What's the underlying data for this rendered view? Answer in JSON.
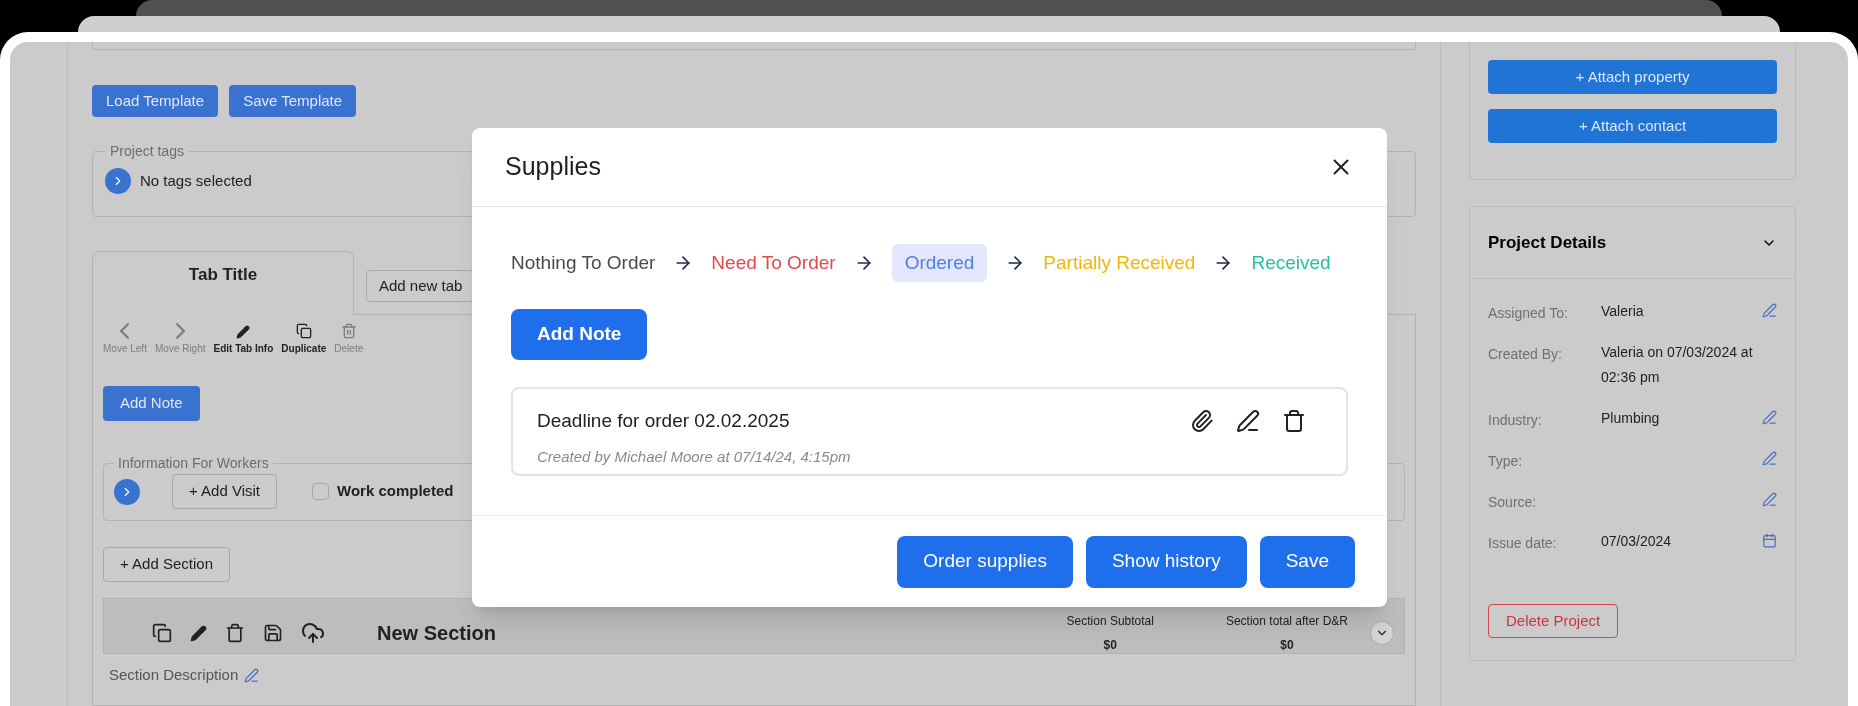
{
  "template_buttons": [
    "Load Template",
    "Save Template"
  ],
  "project_tags": {
    "legend": "Project tags",
    "value": "No tags selected"
  },
  "tabs": [
    {
      "label": "Tab Title",
      "selected": true
    }
  ],
  "add_tab_button": "Add new tab",
  "tab_toolbar": [
    {
      "kind": "left",
      "label": "Move Left",
      "disabled": true
    },
    {
      "kind": "right",
      "label": "Move Right",
      "disabled": true
    },
    {
      "kind": "edit",
      "label": "Edit Tab Info",
      "disabled": false
    },
    {
      "kind": "duplicate",
      "label": "Duplicate",
      "disabled": false
    },
    {
      "kind": "delete",
      "label": "Delete",
      "disabled": true
    }
  ],
  "add_note_button": "Add Note",
  "workers_info": {
    "legend": "Information For Workers",
    "add_visit": "+ Add Visit",
    "work_completed": {
      "label": "Work completed",
      "checked": false
    }
  },
  "add_section_button": "+ Add Section",
  "section": {
    "title": "New Section",
    "expanded": false,
    "totals": [
      {
        "label": "Section Subtotal",
        "value": "$0"
      },
      {
        "label": "Section total after D&R",
        "value": "$0"
      }
    ],
    "description_label": "Section Description"
  },
  "side_buttons": [
    "+ Attach property",
    "+ Attach contact"
  ],
  "project_details": {
    "title": "Project Details",
    "expanded": true,
    "rows": [
      {
        "label": "Assigned To:",
        "value": "Valeria",
        "kind": "edit"
      },
      {
        "label": "Created By:",
        "value": "Valeria on 07/03/2024 at 02:36 pm",
        "kind": "none"
      },
      {
        "label": "Industry:",
        "value": "Plumbing",
        "kind": "edit"
      },
      {
        "label": "Type:",
        "kind": "edit"
      },
      {
        "label": "Source:",
        "kind": "edit"
      },
      {
        "label": "Issue date:",
        "value": "07/03/2024",
        "kind": "date"
      }
    ]
  },
  "delete_button": "Delete Project",
  "modal": {
    "title": "Supplies",
    "statuses": [
      {
        "label": "Nothing To Order",
        "color": "#4a4a4a",
        "selected": false
      },
      {
        "label": "Need To Order",
        "color": "#e5484d",
        "selected": false
      },
      {
        "label": "Ordered",
        "color": "#4f7fe8",
        "selected": true
      },
      {
        "label": "Partially Received",
        "color": "#f2b705",
        "selected": false
      },
      {
        "label": "Received",
        "color": "#22c39a",
        "selected": false
      }
    ],
    "add_note_button": "Add Note",
    "notes": [
      {
        "text": "Deadline for order 02.02.2025",
        "meta": "Created by Michael Moore at 07/14/24, 4:15pm"
      }
    ],
    "buttons": [
      "Order supplies",
      "Show history",
      "Save"
    ]
  }
}
